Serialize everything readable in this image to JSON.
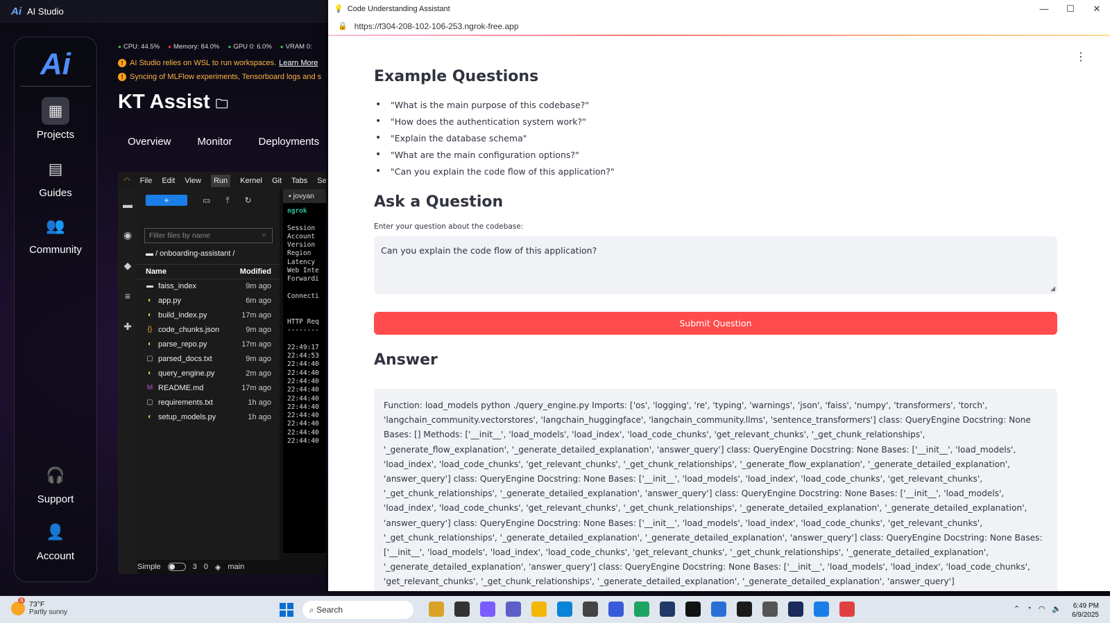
{
  "studio": {
    "title": "AI Studio",
    "nav": {
      "projects": "Projects",
      "guides": "Guides",
      "community": "Community",
      "support": "Support",
      "account": "Account"
    },
    "stats": {
      "cpu": "CPU: 44.5%",
      "memory": "Memory: 84.0%",
      "gpu": "GPU 0: 6.0%",
      "vram": "VRAM 0:"
    },
    "notice1": "AI Studio relies on WSL to run workspaces.",
    "notice1_link": "Learn More",
    "notice2": "Syncing of MLFlow experiments, Tensorboard logs and s",
    "project_title": "KT Assist",
    "tabs": [
      "Overview",
      "Monitor",
      "Deployments"
    ]
  },
  "jupyter": {
    "menu": [
      "File",
      "Edit",
      "View",
      "Run",
      "Kernel",
      "Git",
      "Tabs",
      "Sett"
    ],
    "search_placeholder": "Filter files by name",
    "path": "/ onboarding-assistant /",
    "col_name": "Name",
    "col_modified": "Modified",
    "files": [
      {
        "name": "faiss_index",
        "modified": "9m ago",
        "icon": "folder-icon"
      },
      {
        "name": "app.py",
        "modified": "6m ago",
        "icon": "python-icon"
      },
      {
        "name": "build_index.py",
        "modified": "17m ago",
        "icon": "python-icon"
      },
      {
        "name": "code_chunks.json",
        "modified": "9m ago",
        "icon": "json-icon"
      },
      {
        "name": "parse_repo.py",
        "modified": "17m ago",
        "icon": "python-icon"
      },
      {
        "name": "parsed_docs.txt",
        "modified": "9m ago",
        "icon": "file-icon"
      },
      {
        "name": "query_engine.py",
        "modified": "2m ago",
        "icon": "python-icon"
      },
      {
        "name": "README.md",
        "modified": "17m ago",
        "icon": "markdown-icon"
      },
      {
        "name": "requirements.txt",
        "modified": "1h ago",
        "icon": "file-icon"
      },
      {
        "name": "setup_models.py",
        "modified": "1h ago",
        "icon": "python-icon"
      }
    ],
    "terminal_tab": "jovyan",
    "terminal_lines": [
      "ngrok",
      "",
      "Session",
      "Account",
      "Version",
      "Region",
      "Latency",
      "Web Inte",
      "Forwardi",
      "",
      "Connecti",
      "",
      "",
      "HTTP Req",
      "--------",
      "",
      "22:49:17",
      "22:44:53",
      "22:44:40",
      "22:44:40",
      "22:44:40",
      "22:44:40",
      "22:44:40",
      "22:44:40",
      "22:44:40",
      "22:44:40",
      "22:44:40",
      "22:44:40"
    ],
    "status": {
      "mode": "Simple",
      "count1": "3",
      "count2": "0",
      "branch": "main"
    }
  },
  "browser": {
    "window_title": "Code Understanding Assistant",
    "url": "https://f304-208-102-106-253.ngrok-free.app",
    "examples_title": "Example Questions",
    "examples": [
      "\"What is the main purpose of this codebase?\"",
      "\"How does the authentication system work?\"",
      "\"Explain the database schema\"",
      "\"What are the main configuration options?\"",
      "\"Can you explain the code flow of this application?\""
    ],
    "ask_title": "Ask a Question",
    "question_label": "Enter your question about the codebase:",
    "question_value": "Can you explain the code flow of this application?",
    "submit_label": "Submit Question",
    "answer_title": "Answer",
    "answer_text": "Function: load_models python ./query_engine.py Imports: ['os', 'logging', 're', 'typing', 'warnings', 'json', 'faiss', 'numpy', 'transformers', 'torch', 'langchain_community.vectorstores', 'langchain_huggingface', 'langchain_community.llms', 'sentence_transformers'] class: QueryEngine Docstring: None Bases: [] Methods: ['__init__', 'load_models', 'load_index', 'load_code_chunks', 'get_relevant_chunks', '_get_chunk_relationships', '_generate_flow_explanation', '_generate_detailed_explanation', 'answer_query'] class: QueryEngine Docstring: None Bases: ['__init__', 'load_models', 'load_index', 'load_code_chunks', 'get_relevant_chunks', '_get_chunk_relationships', '_generate_flow_explanation', '_generate_detailed_explanation', 'answer_query'] class: QueryEngine Docstring: None Bases: ['__init__', 'load_models', 'load_index', 'load_code_chunks', 'get_relevant_chunks', '_get_chunk_relationships', '_generate_detailed_explanation', 'answer_query'] class: QueryEngine Docstring: None Bases: ['__init__', 'load_models', 'load_index', 'load_code_chunks', 'get_relevant_chunks', '_get_chunk_relationships', '_generate_detailed_explanation', '_generate_detailed_explanation', 'answer_query'] class: QueryEngine Docstring: None Bases: ['__init__', 'load_models', 'load_index', 'load_code_chunks', 'get_relevant_chunks', '_get_chunk_relationships', '_generate_detailed_explanation', '_generate_detailed_explanation', 'answer_query'] class: QueryEngine Docstring: None Bases: ['__init__', 'load_models', 'load_index', 'load_code_chunks', 'get_relevant_chunks', '_get_chunk_relationships', '_generate_detailed_explanation', '_generate_detailed_explanation', 'answer_query'] class: QueryEngine Docstring: None Bases: ['__init__', 'load_models', 'load_index', 'load_code_chunks', 'get_relevant_chunks', '_get_chunk_relationships', '_generate_detailed_explanation', '_generate_detailed_explanation', 'answer_query']"
  },
  "taskbar": {
    "weather_badge": "6",
    "temp": "73°F",
    "condition": "Partly sunny",
    "search": "Search",
    "time": "6:49 PM",
    "date": "6/9/2025",
    "app_colors": [
      "#d9a227",
      "#333",
      "#7b5cff",
      "#5b5fc7",
      "#f2b705",
      "#0a84d6",
      "#444",
      "#3a5bd9",
      "#1da462",
      "#1f3a68",
      "#111",
      "#2a6fd6",
      "#1b1b1b",
      "#555",
      "#1a2b5c",
      "#1a7ee8",
      "#e04040"
    ]
  },
  "colors": {
    "accent": "#ff4b4b",
    "input_bg": "#f0f2f6",
    "jupyter_blue": "#1a7ee8"
  }
}
